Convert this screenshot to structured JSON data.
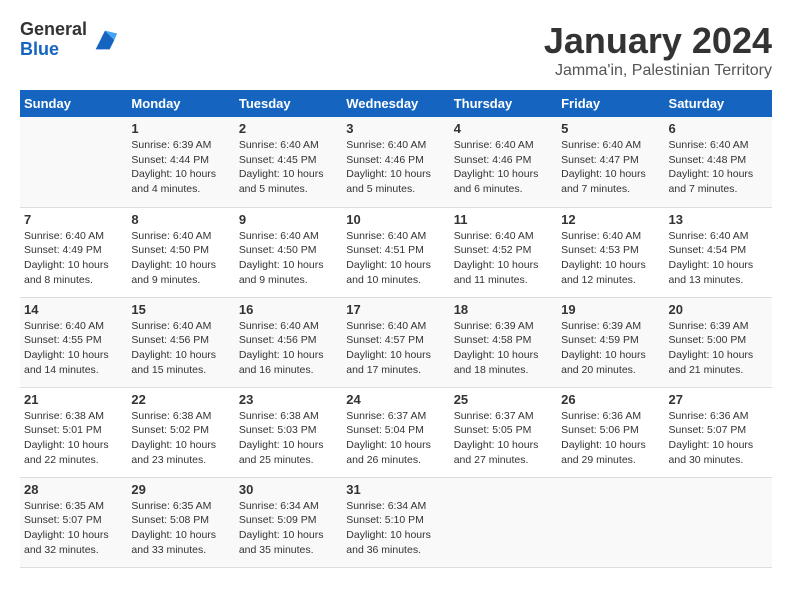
{
  "logo": {
    "general": "General",
    "blue": "Blue"
  },
  "title": "January 2024",
  "subtitle": "Jamma'in, Palestinian Territory",
  "days_header": [
    "Sunday",
    "Monday",
    "Tuesday",
    "Wednesday",
    "Thursday",
    "Friday",
    "Saturday"
  ],
  "weeks": [
    [
      {
        "num": "",
        "detail": ""
      },
      {
        "num": "1",
        "detail": "Sunrise: 6:39 AM\nSunset: 4:44 PM\nDaylight: 10 hours\nand 4 minutes."
      },
      {
        "num": "2",
        "detail": "Sunrise: 6:40 AM\nSunset: 4:45 PM\nDaylight: 10 hours\nand 5 minutes."
      },
      {
        "num": "3",
        "detail": "Sunrise: 6:40 AM\nSunset: 4:46 PM\nDaylight: 10 hours\nand 5 minutes."
      },
      {
        "num": "4",
        "detail": "Sunrise: 6:40 AM\nSunset: 4:46 PM\nDaylight: 10 hours\nand 6 minutes."
      },
      {
        "num": "5",
        "detail": "Sunrise: 6:40 AM\nSunset: 4:47 PM\nDaylight: 10 hours\nand 7 minutes."
      },
      {
        "num": "6",
        "detail": "Sunrise: 6:40 AM\nSunset: 4:48 PM\nDaylight: 10 hours\nand 7 minutes."
      }
    ],
    [
      {
        "num": "7",
        "detail": "Sunrise: 6:40 AM\nSunset: 4:49 PM\nDaylight: 10 hours\nand 8 minutes."
      },
      {
        "num": "8",
        "detail": "Sunrise: 6:40 AM\nSunset: 4:50 PM\nDaylight: 10 hours\nand 9 minutes."
      },
      {
        "num": "9",
        "detail": "Sunrise: 6:40 AM\nSunset: 4:50 PM\nDaylight: 10 hours\nand 9 minutes."
      },
      {
        "num": "10",
        "detail": "Sunrise: 6:40 AM\nSunset: 4:51 PM\nDaylight: 10 hours\nand 10 minutes."
      },
      {
        "num": "11",
        "detail": "Sunrise: 6:40 AM\nSunset: 4:52 PM\nDaylight: 10 hours\nand 11 minutes."
      },
      {
        "num": "12",
        "detail": "Sunrise: 6:40 AM\nSunset: 4:53 PM\nDaylight: 10 hours\nand 12 minutes."
      },
      {
        "num": "13",
        "detail": "Sunrise: 6:40 AM\nSunset: 4:54 PM\nDaylight: 10 hours\nand 13 minutes."
      }
    ],
    [
      {
        "num": "14",
        "detail": "Sunrise: 6:40 AM\nSunset: 4:55 PM\nDaylight: 10 hours\nand 14 minutes."
      },
      {
        "num": "15",
        "detail": "Sunrise: 6:40 AM\nSunset: 4:56 PM\nDaylight: 10 hours\nand 15 minutes."
      },
      {
        "num": "16",
        "detail": "Sunrise: 6:40 AM\nSunset: 4:56 PM\nDaylight: 10 hours\nand 16 minutes."
      },
      {
        "num": "17",
        "detail": "Sunrise: 6:40 AM\nSunset: 4:57 PM\nDaylight: 10 hours\nand 17 minutes."
      },
      {
        "num": "18",
        "detail": "Sunrise: 6:39 AM\nSunset: 4:58 PM\nDaylight: 10 hours\nand 18 minutes."
      },
      {
        "num": "19",
        "detail": "Sunrise: 6:39 AM\nSunset: 4:59 PM\nDaylight: 10 hours\nand 20 minutes."
      },
      {
        "num": "20",
        "detail": "Sunrise: 6:39 AM\nSunset: 5:00 PM\nDaylight: 10 hours\nand 21 minutes."
      }
    ],
    [
      {
        "num": "21",
        "detail": "Sunrise: 6:38 AM\nSunset: 5:01 PM\nDaylight: 10 hours\nand 22 minutes."
      },
      {
        "num": "22",
        "detail": "Sunrise: 6:38 AM\nSunset: 5:02 PM\nDaylight: 10 hours\nand 23 minutes."
      },
      {
        "num": "23",
        "detail": "Sunrise: 6:38 AM\nSunset: 5:03 PM\nDaylight: 10 hours\nand 25 minutes."
      },
      {
        "num": "24",
        "detail": "Sunrise: 6:37 AM\nSunset: 5:04 PM\nDaylight: 10 hours\nand 26 minutes."
      },
      {
        "num": "25",
        "detail": "Sunrise: 6:37 AM\nSunset: 5:05 PM\nDaylight: 10 hours\nand 27 minutes."
      },
      {
        "num": "26",
        "detail": "Sunrise: 6:36 AM\nSunset: 5:06 PM\nDaylight: 10 hours\nand 29 minutes."
      },
      {
        "num": "27",
        "detail": "Sunrise: 6:36 AM\nSunset: 5:07 PM\nDaylight: 10 hours\nand 30 minutes."
      }
    ],
    [
      {
        "num": "28",
        "detail": "Sunrise: 6:35 AM\nSunset: 5:07 PM\nDaylight: 10 hours\nand 32 minutes."
      },
      {
        "num": "29",
        "detail": "Sunrise: 6:35 AM\nSunset: 5:08 PM\nDaylight: 10 hours\nand 33 minutes."
      },
      {
        "num": "30",
        "detail": "Sunrise: 6:34 AM\nSunset: 5:09 PM\nDaylight: 10 hours\nand 35 minutes."
      },
      {
        "num": "31",
        "detail": "Sunrise: 6:34 AM\nSunset: 5:10 PM\nDaylight: 10 hours\nand 36 minutes."
      },
      {
        "num": "",
        "detail": ""
      },
      {
        "num": "",
        "detail": ""
      },
      {
        "num": "",
        "detail": ""
      }
    ]
  ]
}
